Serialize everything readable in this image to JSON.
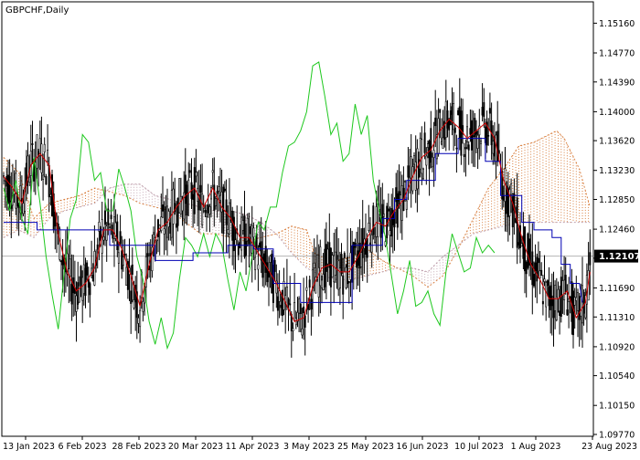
{
  "window": {
    "title": "GBPCHF,Daily"
  },
  "colors": {
    "background": "#ffffff",
    "frame": "#000000",
    "candle": "#000000",
    "tenkan": "#d40000",
    "kijun": "#0000b4",
    "chikou": "#1ec81e",
    "cloud_bull": "#d2691e",
    "cloud_bear": "#b08a9a",
    "price_line": "#b4b4b4",
    "price_label_bg": "#000000",
    "price_label_fg": "#ffffff"
  },
  "chart_data": {
    "type": "candlestick",
    "symbol": "GBPCHF",
    "timeframe": "Daily",
    "ylim": [
      1.0977,
      1.1532
    ],
    "y_ticks": [
      "1.15160",
      "1.14770",
      "1.14390",
      "1.14000",
      "1.13620",
      "1.13230",
      "1.12850",
      "1.12460",
      "1.12080",
      "1.11690",
      "1.11310",
      "1.10920",
      "1.10540",
      "1.10150",
      "1.09770"
    ],
    "x_ticks": [
      "13 Jan 2023",
      "6 Feb 2023",
      "28 Feb 2023",
      "20 Mar 2023",
      "11 Apr 2023",
      "3 May 2023",
      "25 May 2023",
      "16 Jun 2023",
      "10 Jul 2023",
      "1 Aug 2023",
      "23 Aug 2023"
    ],
    "current_price": "1.12107",
    "current_price_value": 1.12107,
    "series": [
      {
        "type": "line",
        "indicator": "tenkan",
        "points": [
          [
            0,
            1.1315
          ],
          [
            6,
            1.13
          ],
          [
            12,
            1.128
          ],
          [
            18,
            1.133
          ],
          [
            24,
            1.1345
          ],
          [
            30,
            1.133
          ],
          [
            36,
            1.124
          ],
          [
            42,
            1.119
          ],
          [
            48,
            1.1165
          ],
          [
            54,
            1.1175
          ],
          [
            60,
            1.1195
          ],
          [
            66,
            1.1245
          ],
          [
            72,
            1.1245
          ],
          [
            78,
            1.122
          ],
          [
            84,
            1.1185
          ],
          [
            90,
            1.1145
          ],
          [
            96,
            1.12
          ],
          [
            102,
            1.1245
          ],
          [
            108,
            1.1255
          ],
          [
            114,
            1.1275
          ],
          [
            120,
            1.129
          ],
          [
            126,
            1.13
          ],
          [
            132,
            1.1275
          ],
          [
            138,
            1.13
          ],
          [
            144,
            1.1275
          ],
          [
            150,
            1.126
          ],
          [
            156,
            1.1235
          ],
          [
            162,
            1.1235
          ],
          [
            168,
            1.1215
          ],
          [
            174,
            1.1195
          ],
          [
            180,
            1.1175
          ],
          [
            186,
            1.115
          ],
          [
            192,
            1.1125
          ],
          [
            198,
            1.113
          ],
          [
            204,
            1.117
          ],
          [
            210,
            1.1195
          ],
          [
            216,
            1.12
          ],
          [
            222,
            1.119
          ],
          [
            228,
            1.119
          ],
          [
            234,
            1.121
          ],
          [
            240,
            1.1235
          ],
          [
            246,
            1.1255
          ],
          [
            252,
            1.125
          ],
          [
            258,
            1.127
          ],
          [
            264,
            1.1285
          ],
          [
            270,
            1.1315
          ],
          [
            276,
            1.134
          ],
          [
            282,
            1.135
          ],
          [
            288,
            1.1375
          ],
          [
            294,
            1.139
          ],
          [
            300,
            1.138
          ],
          [
            306,
            1.1365
          ],
          [
            312,
            1.1375
          ],
          [
            318,
            1.1385
          ],
          [
            324,
            1.1365
          ],
          [
            330,
            1.131
          ],
          [
            336,
            1.128
          ],
          [
            342,
            1.1235
          ],
          [
            348,
            1.12
          ],
          [
            354,
            1.118
          ],
          [
            360,
            1.1155
          ],
          [
            366,
            1.1155
          ],
          [
            372,
            1.1165
          ],
          [
            378,
            1.113
          ],
          [
            384,
            1.115
          ],
          [
            387,
            1.119
          ]
        ]
      },
      {
        "type": "line",
        "indicator": "kijun",
        "points": [
          [
            0,
            1.1255
          ],
          [
            22,
            1.1255
          ],
          [
            22,
            1.1245
          ],
          [
            70,
            1.1245
          ],
          [
            70,
            1.1225
          ],
          [
            100,
            1.1225
          ],
          [
            100,
            1.1205
          ],
          [
            125,
            1.1205
          ],
          [
            125,
            1.1215
          ],
          [
            148,
            1.1215
          ],
          [
            148,
            1.1225
          ],
          [
            165,
            1.1225
          ],
          [
            165,
            1.122
          ],
          [
            178,
            1.122
          ],
          [
            178,
            1.1175
          ],
          [
            196,
            1.1175
          ],
          [
            196,
            1.115
          ],
          [
            230,
            1.115
          ],
          [
            230,
            1.1225
          ],
          [
            250,
            1.1225
          ],
          [
            250,
            1.126
          ],
          [
            258,
            1.126
          ],
          [
            258,
            1.1285
          ],
          [
            266,
            1.1285
          ],
          [
            266,
            1.131
          ],
          [
            285,
            1.131
          ],
          [
            285,
            1.1345
          ],
          [
            300,
            1.1345
          ],
          [
            300,
            1.1365
          ],
          [
            318,
            1.1365
          ],
          [
            318,
            1.1335
          ],
          [
            328,
            1.1335
          ],
          [
            328,
            1.129
          ],
          [
            342,
            1.129
          ],
          [
            342,
            1.1255
          ],
          [
            350,
            1.1255
          ],
          [
            350,
            1.1245
          ],
          [
            362,
            1.1245
          ],
          [
            362,
            1.1235
          ],
          [
            368,
            1.1235
          ],
          [
            368,
            1.12
          ],
          [
            374,
            1.12
          ],
          [
            374,
            1.1175
          ],
          [
            380,
            1.1175
          ],
          [
            382,
            1.115
          ]
        ]
      },
      {
        "type": "line",
        "indicator": "chikou",
        "points": [
          [
            0,
            1.13
          ],
          [
            4,
            1.127
          ],
          [
            8,
            1.131
          ],
          [
            12,
            1.126
          ],
          [
            16,
            1.124
          ],
          [
            20,
            1.134
          ],
          [
            24,
            1.128
          ],
          [
            28,
            1.121
          ],
          [
            32,
            1.116
          ],
          [
            36,
            1.1115
          ],
          [
            40,
            1.119
          ],
          [
            44,
            1.126
          ],
          [
            48,
            1.1285
          ],
          [
            52,
            1.137
          ],
          [
            56,
            1.136
          ],
          [
            60,
            1.131
          ],
          [
            64,
            1.132
          ],
          [
            68,
            1.127
          ],
          [
            72,
            1.127
          ],
          [
            76,
            1.1325
          ],
          [
            80,
            1.13
          ],
          [
            84,
            1.127
          ],
          [
            88,
            1.121
          ],
          [
            92,
            1.118
          ],
          [
            96,
            1.1125
          ],
          [
            100,
            1.1095
          ],
          [
            104,
            1.113
          ],
          [
            108,
            1.109
          ],
          [
            112,
            1.111
          ],
          [
            116,
            1.118
          ],
          [
            120,
            1.1235
          ],
          [
            124,
            1.1225
          ],
          [
            128,
            1.121
          ],
          [
            132,
            1.124
          ],
          [
            136,
            1.121
          ],
          [
            140,
            1.124
          ],
          [
            144,
            1.1225
          ],
          [
            148,
            1.118
          ],
          [
            152,
            1.114
          ],
          [
            156,
            1.119
          ],
          [
            160,
            1.1165
          ],
          [
            164,
            1.121
          ],
          [
            168,
            1.1255
          ],
          [
            172,
            1.1245
          ],
          [
            176,
            1.1275
          ],
          [
            180,
            1.1275
          ],
          [
            184,
            1.132
          ],
          [
            188,
            1.1355
          ],
          [
            192,
            1.136
          ],
          [
            196,
            1.1375
          ],
          [
            200,
            1.14
          ],
          [
            204,
            1.146
          ],
          [
            208,
            1.1465
          ],
          [
            212,
            1.142
          ],
          [
            216,
            1.137
          ],
          [
            220,
            1.1385
          ],
          [
            224,
            1.1335
          ],
          [
            228,
            1.1345
          ],
          [
            232,
            1.141
          ],
          [
            236,
            1.137
          ],
          [
            240,
            1.1395
          ],
          [
            244,
            1.131
          ],
          [
            248,
            1.127
          ],
          [
            252,
            1.1235
          ],
          [
            256,
            1.1185
          ],
          [
            260,
            1.1135
          ],
          [
            264,
            1.1165
          ],
          [
            268,
            1.1205
          ],
          [
            272,
            1.1145
          ],
          [
            276,
            1.115
          ],
          [
            280,
            1.1165
          ],
          [
            284,
            1.1135
          ],
          [
            288,
            1.112
          ],
          [
            292,
            1.119
          ],
          [
            296,
            1.124
          ],
          [
            300,
            1.1215
          ],
          [
            304,
            1.119
          ],
          [
            308,
            1.1195
          ],
          [
            312,
            1.1235
          ],
          [
            316,
            1.1215
          ],
          [
            320,
            1.1225
          ],
          [
            324,
            1.1215
          ]
        ]
      },
      {
        "type": "cloud",
        "indicator": "senkou_span_a",
        "points": [
          [
            0,
            1.134
          ],
          [
            10,
            1.132
          ],
          [
            20,
            1.126
          ],
          [
            30,
            1.128
          ],
          [
            40,
            1.1285
          ],
          [
            50,
            1.129
          ],
          [
            60,
            1.13
          ],
          [
            70,
            1.1295
          ],
          [
            80,
            1.129
          ],
          [
            90,
            1.128
          ],
          [
            100,
            1.1275
          ],
          [
            110,
            1.127
          ],
          [
            120,
            1.1255
          ],
          [
            130,
            1.124
          ],
          [
            140,
            1.124
          ],
          [
            150,
            1.1235
          ],
          [
            160,
            1.123
          ],
          [
            170,
            1.1235
          ],
          [
            180,
            1.124
          ],
          [
            190,
            1.125
          ],
          [
            200,
            1.1245
          ],
          [
            205,
            1.1215
          ],
          [
            210,
            1.121
          ],
          [
            220,
            1.1205
          ],
          [
            230,
            1.121
          ],
          [
            240,
            1.122
          ],
          [
            250,
            1.1205
          ],
          [
            260,
            1.1195
          ],
          [
            270,
            1.1185
          ],
          [
            280,
            1.117
          ],
          [
            290,
            1.1185
          ],
          [
            300,
            1.122
          ],
          [
            310,
            1.126
          ],
          [
            320,
            1.13
          ],
          [
            330,
            1.1325
          ],
          [
            340,
            1.1355
          ],
          [
            350,
            1.136
          ],
          [
            360,
            1.137
          ],
          [
            365,
            1.1375
          ],
          [
            370,
            1.1365
          ],
          [
            380,
            1.1325
          ],
          [
            387,
            1.1275
          ]
        ]
      },
      {
        "type": "cloud",
        "indicator": "senkou_span_b",
        "points": [
          [
            0,
            1.1235
          ],
          [
            10,
            1.1245
          ],
          [
            20,
            1.1235
          ],
          [
            30,
            1.126
          ],
          [
            40,
            1.127
          ],
          [
            50,
            1.1275
          ],
          [
            60,
            1.128
          ],
          [
            70,
            1.13
          ],
          [
            80,
            1.1305
          ],
          [
            90,
            1.1305
          ],
          [
            100,
            1.129
          ],
          [
            110,
            1.1285
          ],
          [
            120,
            1.128
          ],
          [
            130,
            1.1275
          ],
          [
            140,
            1.127
          ],
          [
            150,
            1.127
          ],
          [
            160,
            1.1265
          ],
          [
            170,
            1.1255
          ],
          [
            180,
            1.124
          ],
          [
            190,
            1.1215
          ],
          [
            200,
            1.1195
          ],
          [
            210,
            1.1185
          ],
          [
            220,
            1.118
          ],
          [
            230,
            1.118
          ],
          [
            240,
            1.1185
          ],
          [
            250,
            1.119
          ],
          [
            260,
            1.1195
          ],
          [
            270,
            1.1195
          ],
          [
            280,
            1.119
          ],
          [
            290,
            1.121
          ],
          [
            300,
            1.1225
          ],
          [
            310,
            1.124
          ],
          [
            320,
            1.1245
          ],
          [
            330,
            1.125
          ],
          [
            340,
            1.1255
          ],
          [
            350,
            1.1255
          ],
          [
            360,
            1.1255
          ],
          [
            370,
            1.1255
          ],
          [
            380,
            1.1255
          ],
          [
            387,
            1.1255
          ]
        ]
      }
    ]
  }
}
